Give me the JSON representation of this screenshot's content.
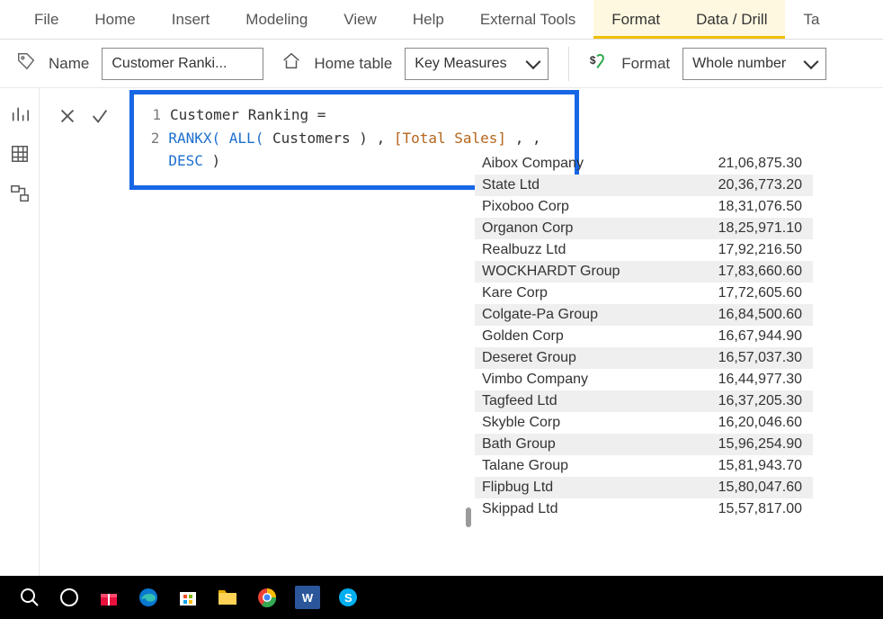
{
  "ribbon": {
    "tabs": [
      "File",
      "Home",
      "Insert",
      "Modeling",
      "View",
      "Help",
      "External Tools",
      "Format",
      "Data / Drill",
      "Ta"
    ],
    "active_index": 7
  },
  "property_bar": {
    "name_label": "Name",
    "name_value": "Customer Ranki...",
    "home_table_label": "Home table",
    "home_table_value": "Key Measures",
    "format_label": "Format",
    "format_value": "Whole number"
  },
  "formula": {
    "line1_num": "1",
    "line1_code": "Customer Ranking =",
    "line2_num": "2",
    "line2_rankx": "RANKX(",
    "line2_all": " ALL(",
    "line2_customers": " Customers ",
    "line2_p1": ") , ",
    "line2_measure": "[Total Sales]",
    "line2_p2": " , , ",
    "line2_desc": "DESC",
    "line2_p3": " )"
  },
  "table": {
    "rows": [
      {
        "name": "Aibox Company",
        "value": "21,06,875.30"
      },
      {
        "name": "State Ltd",
        "value": "20,36,773.20"
      },
      {
        "name": "Pixoboo Corp",
        "value": "18,31,076.50"
      },
      {
        "name": "Organon Corp",
        "value": "18,25,971.10"
      },
      {
        "name": "Realbuzz Ltd",
        "value": "17,92,216.50"
      },
      {
        "name": "WOCKHARDT Group",
        "value": "17,83,660.60"
      },
      {
        "name": "Kare Corp",
        "value": "17,72,605.60"
      },
      {
        "name": "Colgate-Pa Group",
        "value": "16,84,500.60"
      },
      {
        "name": "Golden Corp",
        "value": "16,67,944.90"
      },
      {
        "name": "Deseret Group",
        "value": "16,57,037.30"
      },
      {
        "name": "Vimbo Company",
        "value": "16,44,977.30"
      },
      {
        "name": "Tagfeed Ltd",
        "value": "16,37,205.30"
      },
      {
        "name": "Skyble Corp",
        "value": "16,20,046.60"
      },
      {
        "name": "Bath Group",
        "value": "15,96,254.90"
      },
      {
        "name": "Talane Group",
        "value": "15,81,943.70"
      },
      {
        "name": "Flipbug Ltd",
        "value": "15,80,047.60"
      },
      {
        "name": "Skippad Ltd",
        "value": "15,57,817.00"
      }
    ]
  },
  "taskbar": {
    "word_label": "W"
  }
}
